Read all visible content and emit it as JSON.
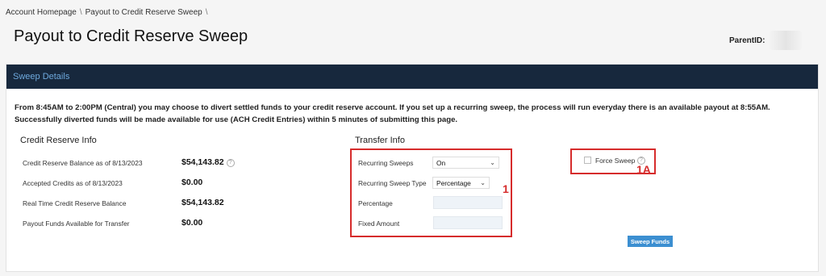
{
  "breadcrumb": {
    "items": [
      "Account Homepage",
      "Payout to Credit Reserve Sweep"
    ],
    "separator": "\\"
  },
  "page": {
    "title": "Payout to Credit Reserve Sweep",
    "parent_id_label": "ParentID:"
  },
  "panel": {
    "header": "Sweep Details",
    "info_text": "From 8:45AM to 2:00PM (Central) you may choose to divert settled funds to your credit reserve account. If you set up a recurring sweep, the process will run everyday there is an available payout at 8:55AM. Successfully diverted funds will be made available for use (ACH Credit Entries) within 5 minutes of submitting this page."
  },
  "credit_reserve": {
    "title": "Credit Reserve Info",
    "rows": [
      {
        "label": "Credit Reserve Balance as of 8/13/2023",
        "value": "$54,143.82"
      },
      {
        "label": "Accepted Credits as of 8/13/2023",
        "value": "$0.00"
      },
      {
        "label": "Real Time Credit Reserve Balance",
        "value": "$54,143.82"
      },
      {
        "label": "Payout Funds Available for Transfer",
        "value": "$0.00"
      }
    ]
  },
  "transfer": {
    "title": "Transfer Info",
    "recurring_sweeps_label": "Recurring Sweeps",
    "recurring_sweeps_value": "On",
    "sweep_type_label": "Recurring Sweep Type",
    "sweep_type_value": "Percentage",
    "percentage_label": "Percentage",
    "percentage_value": "",
    "fixed_amount_label": "Fixed Amount",
    "fixed_amount_value": ""
  },
  "force_sweep": {
    "label": "Force Sweep",
    "checked": false
  },
  "annotations": {
    "box1": "1",
    "box1a": "1A"
  },
  "actions": {
    "sweep_button": "Sweep Funds"
  },
  "icons": {
    "help": "question-circle-icon",
    "chevron": "chevron-down-icon"
  },
  "colors": {
    "header_bg": "#17283d",
    "header_text": "#6ea9dd",
    "annotation_red": "#d62c2c",
    "button_blue": "#3c8fd1"
  }
}
